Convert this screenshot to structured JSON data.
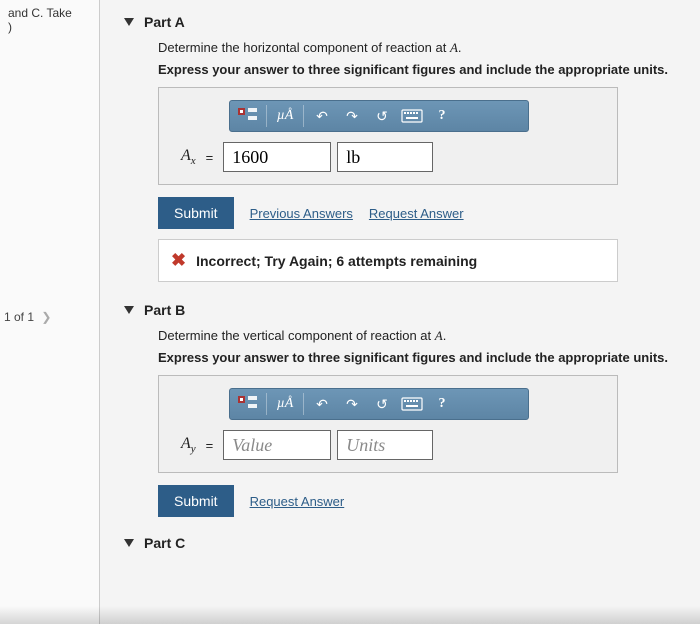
{
  "leftSidebar": {
    "text_line1": "and C. Take",
    "text_line2": ")"
  },
  "pageNav": {
    "label": "1 of 1"
  },
  "partA": {
    "title": "Part A",
    "instruction": "Determine the horizontal component of reaction at A.",
    "sub_instruction": "Express your answer to three significant figures and include the appropriate units.",
    "toolbar": {
      "templates": "templates-icon",
      "mu": "µÅ",
      "undo": "↶",
      "redo": "↷",
      "reset": "↺",
      "keyboard": "keyboard-icon",
      "help": "?"
    },
    "variable": "A",
    "subscript": "x",
    "equals": "=",
    "value": "1600",
    "units": "lb",
    "submit": "Submit",
    "previous_answers": "Previous Answers",
    "request_answer": "Request Answer",
    "feedback": "Incorrect; Try Again; 6 attempts remaining"
  },
  "partB": {
    "title": "Part B",
    "instruction": "Determine the vertical component of reaction at A.",
    "sub_instruction": "Express your answer to three significant figures and include the appropriate units.",
    "toolbar": {
      "templates": "templates-icon",
      "mu": "µÅ",
      "undo": "↶",
      "redo": "↷",
      "reset": "↺",
      "keyboard": "keyboard-icon",
      "help": "?"
    },
    "variable": "A",
    "subscript": "y",
    "equals": "=",
    "value_placeholder": "Value",
    "units_placeholder": "Units",
    "submit": "Submit",
    "request_answer": "Request Answer"
  },
  "partC": {
    "title": "Part C"
  }
}
